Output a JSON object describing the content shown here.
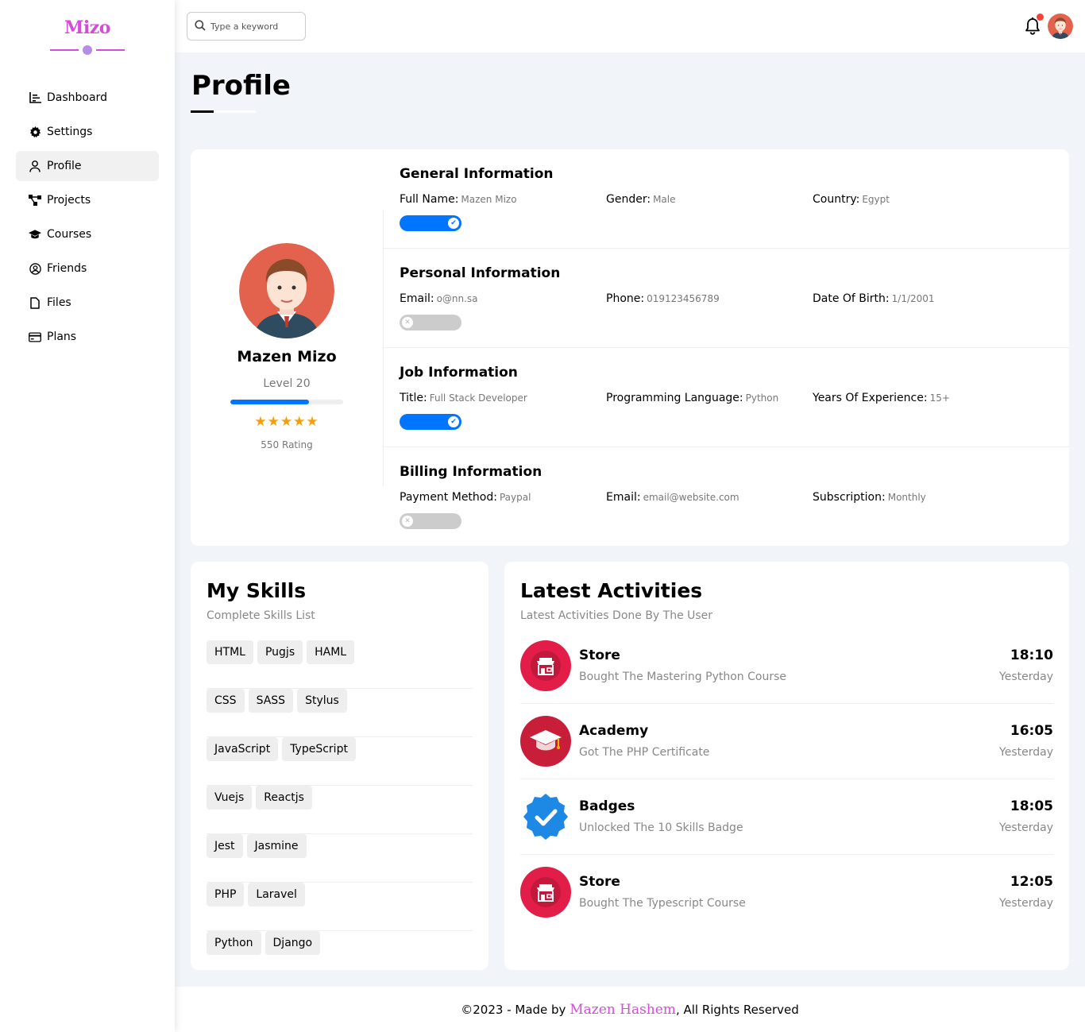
{
  "app": {
    "logo": "Mizo"
  },
  "sidebar": {
    "items": [
      {
        "label": "Dashboard",
        "icon": "chart-icon"
      },
      {
        "label": "Settings",
        "icon": "gear-icon"
      },
      {
        "label": "Profile",
        "icon": "user-icon",
        "active": true
      },
      {
        "label": "Projects",
        "icon": "diagram-icon"
      },
      {
        "label": "Courses",
        "icon": "graduation-cap-icon"
      },
      {
        "label": "Friends",
        "icon": "user-circle-icon"
      },
      {
        "label": "Files",
        "icon": "file-icon"
      },
      {
        "label": "Plans",
        "icon": "credit-card-icon"
      }
    ]
  },
  "header": {
    "search_placeholder": "Type a keyword",
    "has_notification": true
  },
  "page": {
    "title": "Profile"
  },
  "profile": {
    "name": "Mazen Mizo",
    "level": "Level 20",
    "level_progress": 0.7,
    "stars": "★★★★★",
    "rating": "550 Rating"
  },
  "info_sections": [
    {
      "title": "General Information",
      "toggle_on": true,
      "fields": [
        {
          "label": "Full Name:",
          "value": "Mazen Mizo"
        },
        {
          "label": "Gender:",
          "value": "Male"
        },
        {
          "label": "Country:",
          "value": "Egypt"
        }
      ]
    },
    {
      "title": "Personal Information",
      "toggle_on": false,
      "fields": [
        {
          "label": "Email:",
          "value": "o@nn.sa"
        },
        {
          "label": "Phone:",
          "value": "019123456789"
        },
        {
          "label": "Date Of Birth:",
          "value": "1/1/2001"
        }
      ]
    },
    {
      "title": "Job Information",
      "toggle_on": true,
      "fields": [
        {
          "label": "Title:",
          "value": "Full Stack Developer"
        },
        {
          "label": "Programming Language:",
          "value": "Python"
        },
        {
          "label": "Years Of Experience:",
          "value": "15+"
        }
      ]
    },
    {
      "title": "Billing Information",
      "toggle_on": false,
      "fields": [
        {
          "label": "Payment Method:",
          "value": "Paypal"
        },
        {
          "label": "Email:",
          "value": "email@website.com"
        },
        {
          "label": "Subscription:",
          "value": "Monthly"
        }
      ]
    }
  ],
  "skills": {
    "title": "My Skills",
    "subtitle": "Complete Skills List",
    "rows": [
      [
        "HTML",
        "Pugjs",
        "HAML"
      ],
      [
        "CSS",
        "SASS",
        "Stylus"
      ],
      [
        "JavaScript",
        "TypeScript"
      ],
      [
        "Vuejs",
        "Reactjs"
      ],
      [
        "Jest",
        "Jasmine"
      ],
      [
        "PHP",
        "Laravel"
      ],
      [
        "Python",
        "Django"
      ]
    ]
  },
  "activities": {
    "title": "Latest Activities",
    "subtitle": "Latest Activities Done By The User",
    "items": [
      {
        "title": "Store",
        "desc": "Bought The Mastering Python Course",
        "time": "18:10",
        "day": "Yesterday",
        "icon": "store-icon"
      },
      {
        "title": "Academy",
        "desc": "Got The PHP Certificate",
        "time": "16:05",
        "day": "Yesterday",
        "icon": "graduation-cap-icon"
      },
      {
        "title": "Badges",
        "desc": "Unlocked The 10 Skills Badge",
        "time": "18:05",
        "day": "Yesterday",
        "icon": "verified-badge-icon"
      },
      {
        "title": "Store",
        "desc": "Bought The Typescript Course",
        "time": "12:05",
        "day": "Yesterday",
        "icon": "store-icon"
      }
    ]
  },
  "footer": {
    "prefix": "©2023 - Made by ",
    "author": "Mazen Hashem",
    "suffix": ", All Rights Reserved"
  },
  "colors": {
    "accent": "#0075ff",
    "brand": "#d44cd8",
    "star": "#f59e0b",
    "store_red": "#e11d48",
    "badge_blue": "#1e88e5"
  }
}
